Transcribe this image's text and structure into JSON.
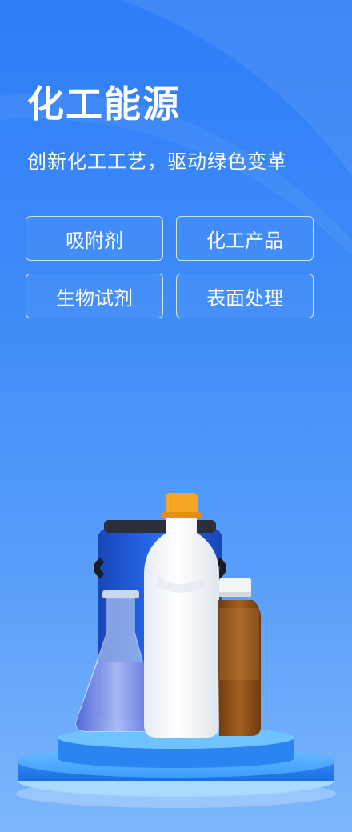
{
  "hero": {
    "title": "化工能源",
    "subtitle": "创新化工工艺，驱动绿色变革"
  },
  "tags": [
    {
      "label": "吸附剂"
    },
    {
      "label": "化工产品"
    },
    {
      "label": "生物试剂"
    },
    {
      "label": "表面处理"
    }
  ],
  "colors": {
    "background_top": "#2f7df7",
    "background_bottom": "#7db6fb",
    "tag_border": "#ffffff",
    "cap_orange": "#f5a623",
    "drum_blue": "#1f5fe0",
    "amber_bottle": "#8a4a14"
  },
  "illustration": {
    "items": [
      "blue-drum-icon",
      "erlenmeyer-flask-icon",
      "white-bottle-icon",
      "amber-bottle-icon",
      "podium-icon"
    ]
  }
}
